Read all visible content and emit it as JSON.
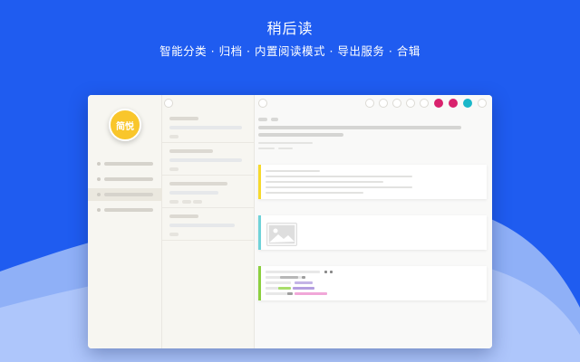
{
  "hero": {
    "title": "稍后读",
    "subtitle": "智能分类 · 归档 · 内置阅读模式 · 导出服务 · 合辑"
  },
  "colors": {
    "background": "#1f5cf0",
    "accent_yellow": "#f9c62b",
    "accent_cyan": "#6fd2d8",
    "accent_green": "#8ccf3f",
    "accent_pink": "#d9226d",
    "accent_teal": "#1ab7c9"
  },
  "sidebar": {
    "logo_label": "简悦",
    "logo_icon": "logo-badge",
    "active_item": 2
  },
  "reader": {
    "toolbar_colors": [
      "#d9226d",
      "#d9226d",
      "#1ab7c9"
    ],
    "image_placeholder_icon": "image-icon"
  }
}
